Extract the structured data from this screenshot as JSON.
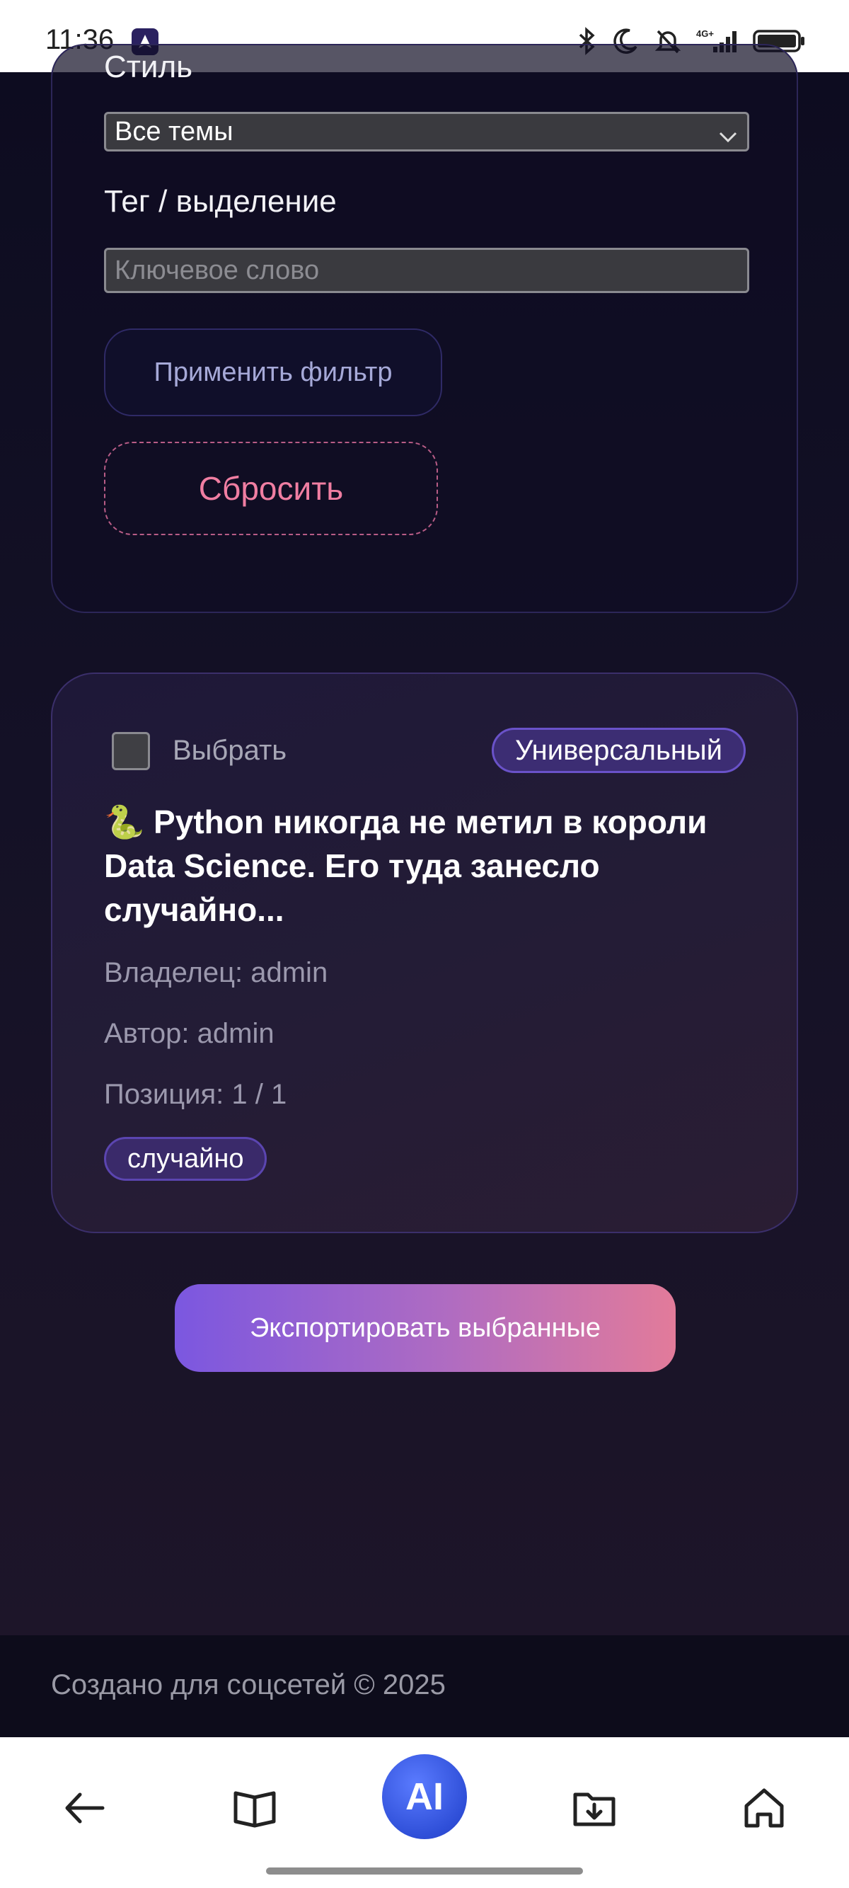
{
  "status_bar": {
    "time": "11:36"
  },
  "filters": {
    "style_label": "Стиль",
    "style_value": "Все темы",
    "tag_label": "Тег / выделение",
    "tag_placeholder": "Ключевое слово",
    "apply_label": "Применить фильтр",
    "reset_label": "Сбросить"
  },
  "post": {
    "select_label": "Выбрать",
    "type_badge": "Универсальный",
    "title": "🐍 Python никогда не метил в короли Data Science. Его туда занесло случайно...",
    "owner": "Владелец: admin",
    "author": "Автор: admin",
    "position": "Позиция: 1 / 1",
    "tag": "случайно"
  },
  "export_label": "Экспортировать выбранные",
  "footer": {
    "text": "Создано для соцсетей © 2025"
  },
  "navbar": {
    "ai_label": "AI"
  }
}
